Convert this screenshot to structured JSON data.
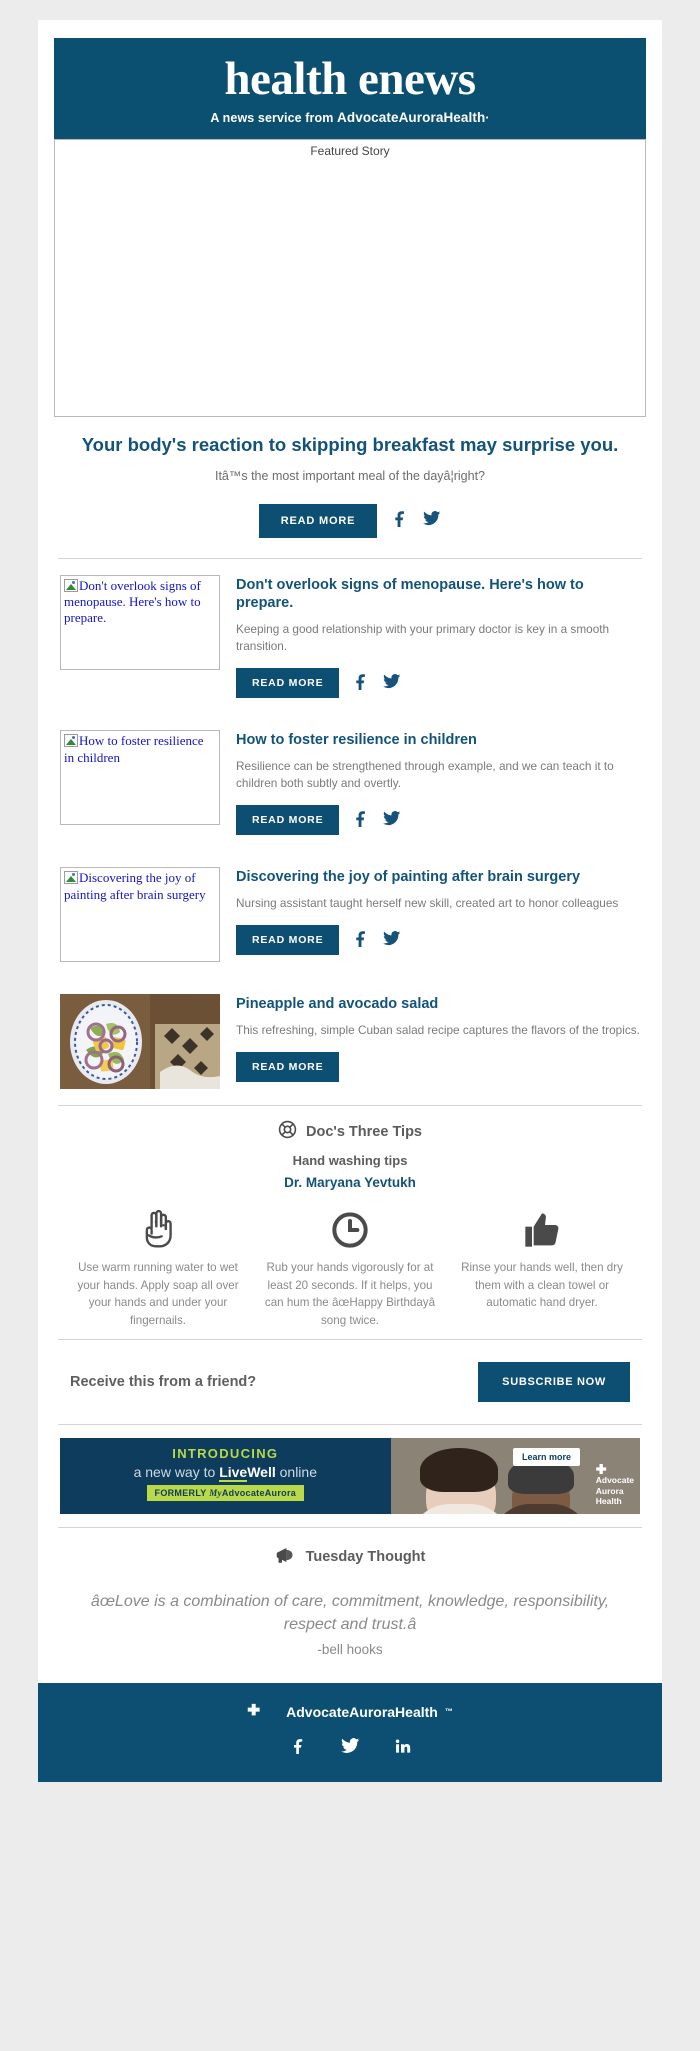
{
  "theme": {
    "brand_blue": "#0b4f71",
    "link_blue": "#13537a",
    "button_blue": "#0d4f73",
    "body_gray": "#7a7a7a",
    "page_bg": "#ececec",
    "ad_navy": "#0d3c5c",
    "ad_green": "#b9d949"
  },
  "header": {
    "title": "health enews",
    "tagline_prefix": "A news service from ",
    "brand": "AdvocateAuroraHealth",
    "brand_mark": "·"
  },
  "featured": {
    "image_alt": "Featured Story",
    "title": "Your body's reaction to skipping breakfast may surprise you.",
    "subtitle": "Itâ™s the most important meal of the dayâ¦right?",
    "read_more_label": "READ MORE",
    "facebook_icon": "facebook-icon",
    "twitter_icon": "twitter-icon"
  },
  "articles": [
    {
      "image_alt": "Don't overlook signs of menopause. Here's how to prepare.",
      "image_kind": "broken",
      "title": "Don't overlook signs of menopause. Here's how to prepare.",
      "description": "Keeping a good relationship with your primary doctor is key in a smooth transition.",
      "read_more_label": "READ MORE",
      "has_social": true
    },
    {
      "image_alt": "How to foster resilience in children",
      "image_kind": "broken",
      "title": "How to foster resilience in children",
      "description": "Resilience can be strengthened through example, and we can teach it to children both subtly and overtly.",
      "read_more_label": "READ MORE",
      "has_social": true
    },
    {
      "image_alt": "Discovering the joy of painting after brain surgery",
      "image_kind": "broken",
      "title": "Discovering the joy of painting after brain surgery",
      "description": "Nursing assistant taught herself new skill, created art to honor colleagues",
      "read_more_label": "READ MORE",
      "has_social": true
    },
    {
      "image_alt": "Pineapple and avocado salad",
      "image_kind": "photo",
      "title": "Pineapple and avocado salad",
      "description": "This refreshing, simple Cuban salad recipe captures the flavors of the tropics.",
      "read_more_label": "READ MORE",
      "has_social": false
    }
  ],
  "tips": {
    "icon": "lifebuoy-icon",
    "heading": "Doc's Three Tips",
    "subheading": "Hand washing tips",
    "doctor": "Dr. Maryana Yevtukh",
    "items": [
      {
        "icon": "hand-soap-icon",
        "text": "Use warm running water to wet your hands. Apply soap all over your hands and under your fingernails."
      },
      {
        "icon": "clock-icon",
        "text": "Rub your hands vigorously for at least 20 seconds. If it helps, you can hum the âœHappy Birthdayâ song twice."
      },
      {
        "icon": "thumbs-up-icon",
        "text": "Rinse your hands well, then dry them with a clean towel or automatic hand dryer."
      }
    ]
  },
  "subscribe": {
    "prompt": "Receive this from a friend?",
    "button_label": "SUBSCRIBE NOW"
  },
  "ad": {
    "introducing": "INTRODUCING",
    "line2_prefix": "a new way to ",
    "live": "Live",
    "well": "Well",
    "line2_suffix": " online",
    "formerly_prefix": "FORMERLY ",
    "formerly_my": "My",
    "formerly_brand": "AdvocateAurora",
    "learn_more": "Learn more",
    "logo_line1": "Advocate",
    "logo_line2": "Aurora",
    "logo_line3": "Health"
  },
  "quote": {
    "icon": "megaphone-icon",
    "heading": "Tuesday Thought",
    "text": "âœLove is a combination of care, commitment, knowledge, responsibility, respect and trust.â",
    "author": "-bell hooks"
  },
  "footer": {
    "logo_icon": "advocate-aurora-logo-icon",
    "brand": "AdvocateAuroraHealth",
    "trademark": "™",
    "social": [
      {
        "icon": "facebook-icon",
        "name": "Facebook"
      },
      {
        "icon": "twitter-icon",
        "name": "Twitter"
      },
      {
        "icon": "linkedin-icon",
        "name": "LinkedIn"
      }
    ]
  }
}
